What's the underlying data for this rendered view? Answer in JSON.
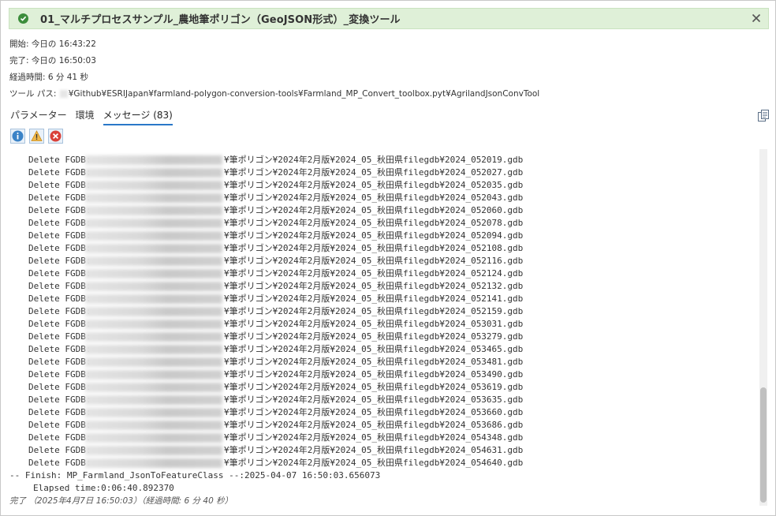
{
  "banner": {
    "title": "01_マルチプロセスサンプル_農地筆ポリゴン（GeoJSON形式）_変換ツール",
    "status_color": "#3c8d3c"
  },
  "meta": {
    "start_label": "開始:",
    "start_value": "今日の 16:43:22",
    "end_label": "完了:",
    "end_value": "今日の 16:50:03",
    "elapsed_label": "経過時間:",
    "elapsed_value": "6 分 41 秒",
    "path_label": "ツール パス:",
    "path_value": "¥Github¥ESRIJapan¥farmland-polygon-conversion-tools¥Farmland_MP_Convert_toolbox.pyt¥AgrilandJsonConvTool"
  },
  "tabs": [
    {
      "label": "パラメーター"
    },
    {
      "label": "環境"
    },
    {
      "label": "メッセージ (83)"
    }
  ],
  "filters": {
    "info_icon": "info-icon",
    "warning_icon": "warning-icon",
    "error_icon": "error-icon"
  },
  "log": {
    "prefix": "Delete FGDB:",
    "path_suffix": "¥筆ポリゴン¥2024年2月版¥2024_05_秋田県filegdb¥",
    "files": [
      "2024_052019.gdb",
      "2024_052027.gdb",
      "2024_052035.gdb",
      "2024_052043.gdb",
      "2024_052060.gdb",
      "2024_052078.gdb",
      "2024_052094.gdb",
      "2024_052108.gdb",
      "2024_052116.gdb",
      "2024_052124.gdb",
      "2024_052132.gdb",
      "2024_052141.gdb",
      "2024_052159.gdb",
      "2024_053031.gdb",
      "2024_053279.gdb",
      "2024_053465.gdb",
      "2024_053481.gdb",
      "2024_053490.gdb",
      "2024_053619.gdb",
      "2024_053635.gdb",
      "2024_053660.gdb",
      "2024_053686.gdb",
      "2024_054348.gdb",
      "2024_054631.gdb",
      "2024_054640.gdb"
    ],
    "finish_line": "-- Finish: MP_Farmland_JsonToFeatureClass --:2025-04-07 16:50:03.656073",
    "elapsed_line": "Elapsed time:0:06:40.892370",
    "done_line": "完了 （2025年4月7日 16:50:03）（経過時間: 6 分 40 秒）"
  },
  "scroll": {
    "position": 0.95
  }
}
